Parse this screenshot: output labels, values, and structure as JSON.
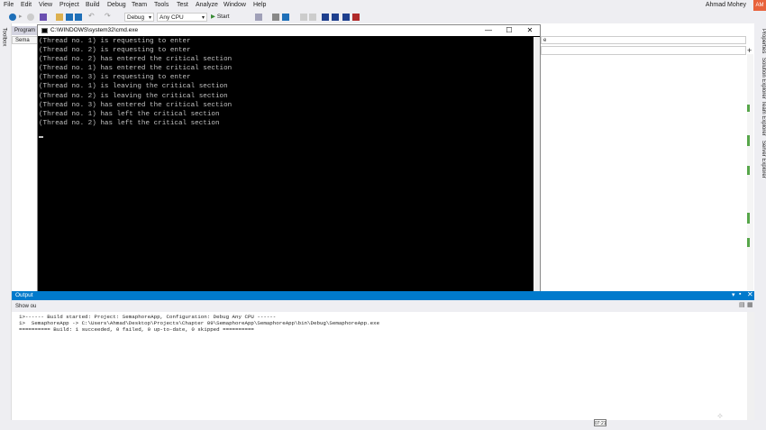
{
  "menu": {
    "items": [
      "File",
      "Edit",
      "View",
      "Project",
      "Build",
      "Debug",
      "Team",
      "Tools",
      "Test",
      "Analyze",
      "Window",
      "Help"
    ],
    "user_name": "Ahmad Mohey",
    "user_initials": "AM"
  },
  "toolbar": {
    "config": "Debug",
    "platform": "Any CPU",
    "start_label": "Start"
  },
  "toolbox": {
    "label": "Toolbox"
  },
  "right_panels": [
    "Properties",
    "Solution Explorer",
    "Team Explorer",
    "Server Explorer"
  ],
  "editor": {
    "tab_label": "Program",
    "tab2_label": "Sema",
    "right_combo_value": "e"
  },
  "cmd": {
    "title": "C:\\WINDOWS\\system32\\cmd.exe",
    "lines": [
      "(Thread no. 1) is requesting to enter",
      "(Thread no. 2) is requesting to enter",
      "(Thread no. 2) has entered the critical section",
      "(Thread no. 1) has entered the critical section",
      "(Thread no. 3) is requesting to enter",
      "(Thread no. 1) is leaving the critical section",
      "(Thread no. 2) is leaving the critical section",
      "(Thread no. 3) has entered the critical section",
      "(Thread no. 1) has left the critical section",
      "(Thread no. 2) has left the critical section"
    ],
    "minimize": "—",
    "maximize": "☐",
    "close": "✕"
  },
  "output": {
    "title": "Output",
    "show_output_from": "Show ou",
    "lines": [
      "1>------ Build started: Project: SemaphoreApp, Configuration: Debug Any CPU ------",
      "1>  SemaphoreApp -> C:\\Users\\Ahmad\\Desktop\\Projects\\Chapter 09\\SemaphoreApp\\SemaphoreApp\\bin\\Debug\\SemaphoreApp.exe",
      "========== Build: 1 succeeded, 0 failed, 0 up-to-date, 0 skipped =========="
    ]
  },
  "status": {
    "time": "07:21"
  },
  "colors": {
    "accent": "#007acc",
    "user_badge": "#e8623b",
    "console_bg": "#000000",
    "console_fg": "#c0c0c0"
  }
}
